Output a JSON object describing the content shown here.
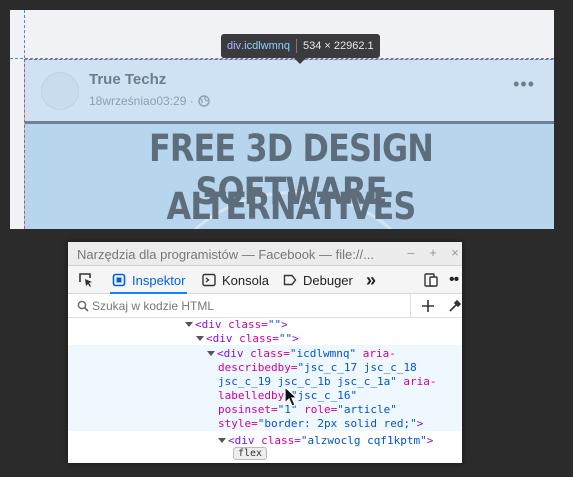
{
  "viewport": {
    "post": {
      "author": "True Techz",
      "date": "18wrześniao03:29 ·",
      "more_label": "•••",
      "image_title_line1": "FREE 3D DESIGN SOFTWARE",
      "image_title_line2": "ALTERNATIVES"
    },
    "tooltip": {
      "tag": "div",
      "class_name": ".icdlwmnq",
      "dimensions": "534 × 22962.1"
    }
  },
  "devtools": {
    "title": "Narzędzia dla programistów — Facebook — file://...",
    "window_buttons": [
      "–",
      "+",
      "×"
    ],
    "tabs": [
      {
        "label": "Inspektor",
        "icon": "inspector-icon",
        "selected": true
      },
      {
        "label": "Konsola",
        "icon": "console-icon",
        "selected": false
      },
      {
        "label": "Debuger",
        "icon": "debugger-icon",
        "selected": false
      }
    ],
    "overflow_label": "»",
    "search_placeholder": "Szukaj w kodzie HTML",
    "code_lines": {
      "l1_tag": "<div",
      "l1_attr": " class=",
      "l1_val": "\"\"",
      "l1_end": ">",
      "l2_tag": "<div",
      "l2_attr": " class=",
      "l2_val": "\"\"",
      "l2_end": ">",
      "l3_tag": "<div",
      "l3_attr": " class=",
      "l3_val": "\"icdlwmnq\"",
      "l3_attr2": " aria-",
      "l4_attr": "describedby=",
      "l4_val": "\"jsc_c_17 jsc_c_18",
      "l5_val": "jsc_c_19 jsc_c_1b jsc_c_1a\"",
      "l5_attr": " aria-",
      "l6_attr": "labelledby=",
      "l6_val": "\"jsc_c_16\"",
      "l7_attr": "posinset=",
      "l7_val": "\"1\"",
      "l7_attr2": " role=",
      "l7_val2": "\"article\"",
      "l8_attr": "style=",
      "l8_val": "\"border: 2px solid red;\"",
      "l8_end": ">",
      "l9_tag": "<div",
      "l9_attr": " class=",
      "l9_val": "\"alzwoclg cqf1kptm\"",
      "l9_end": ">"
    },
    "badge": "flex"
  },
  "colors": {
    "highlight": "#a9cdea",
    "selected_tab": "#0061e0",
    "tag": "#8214d0",
    "attribute": "#d20096",
    "value": "#0055cc"
  }
}
